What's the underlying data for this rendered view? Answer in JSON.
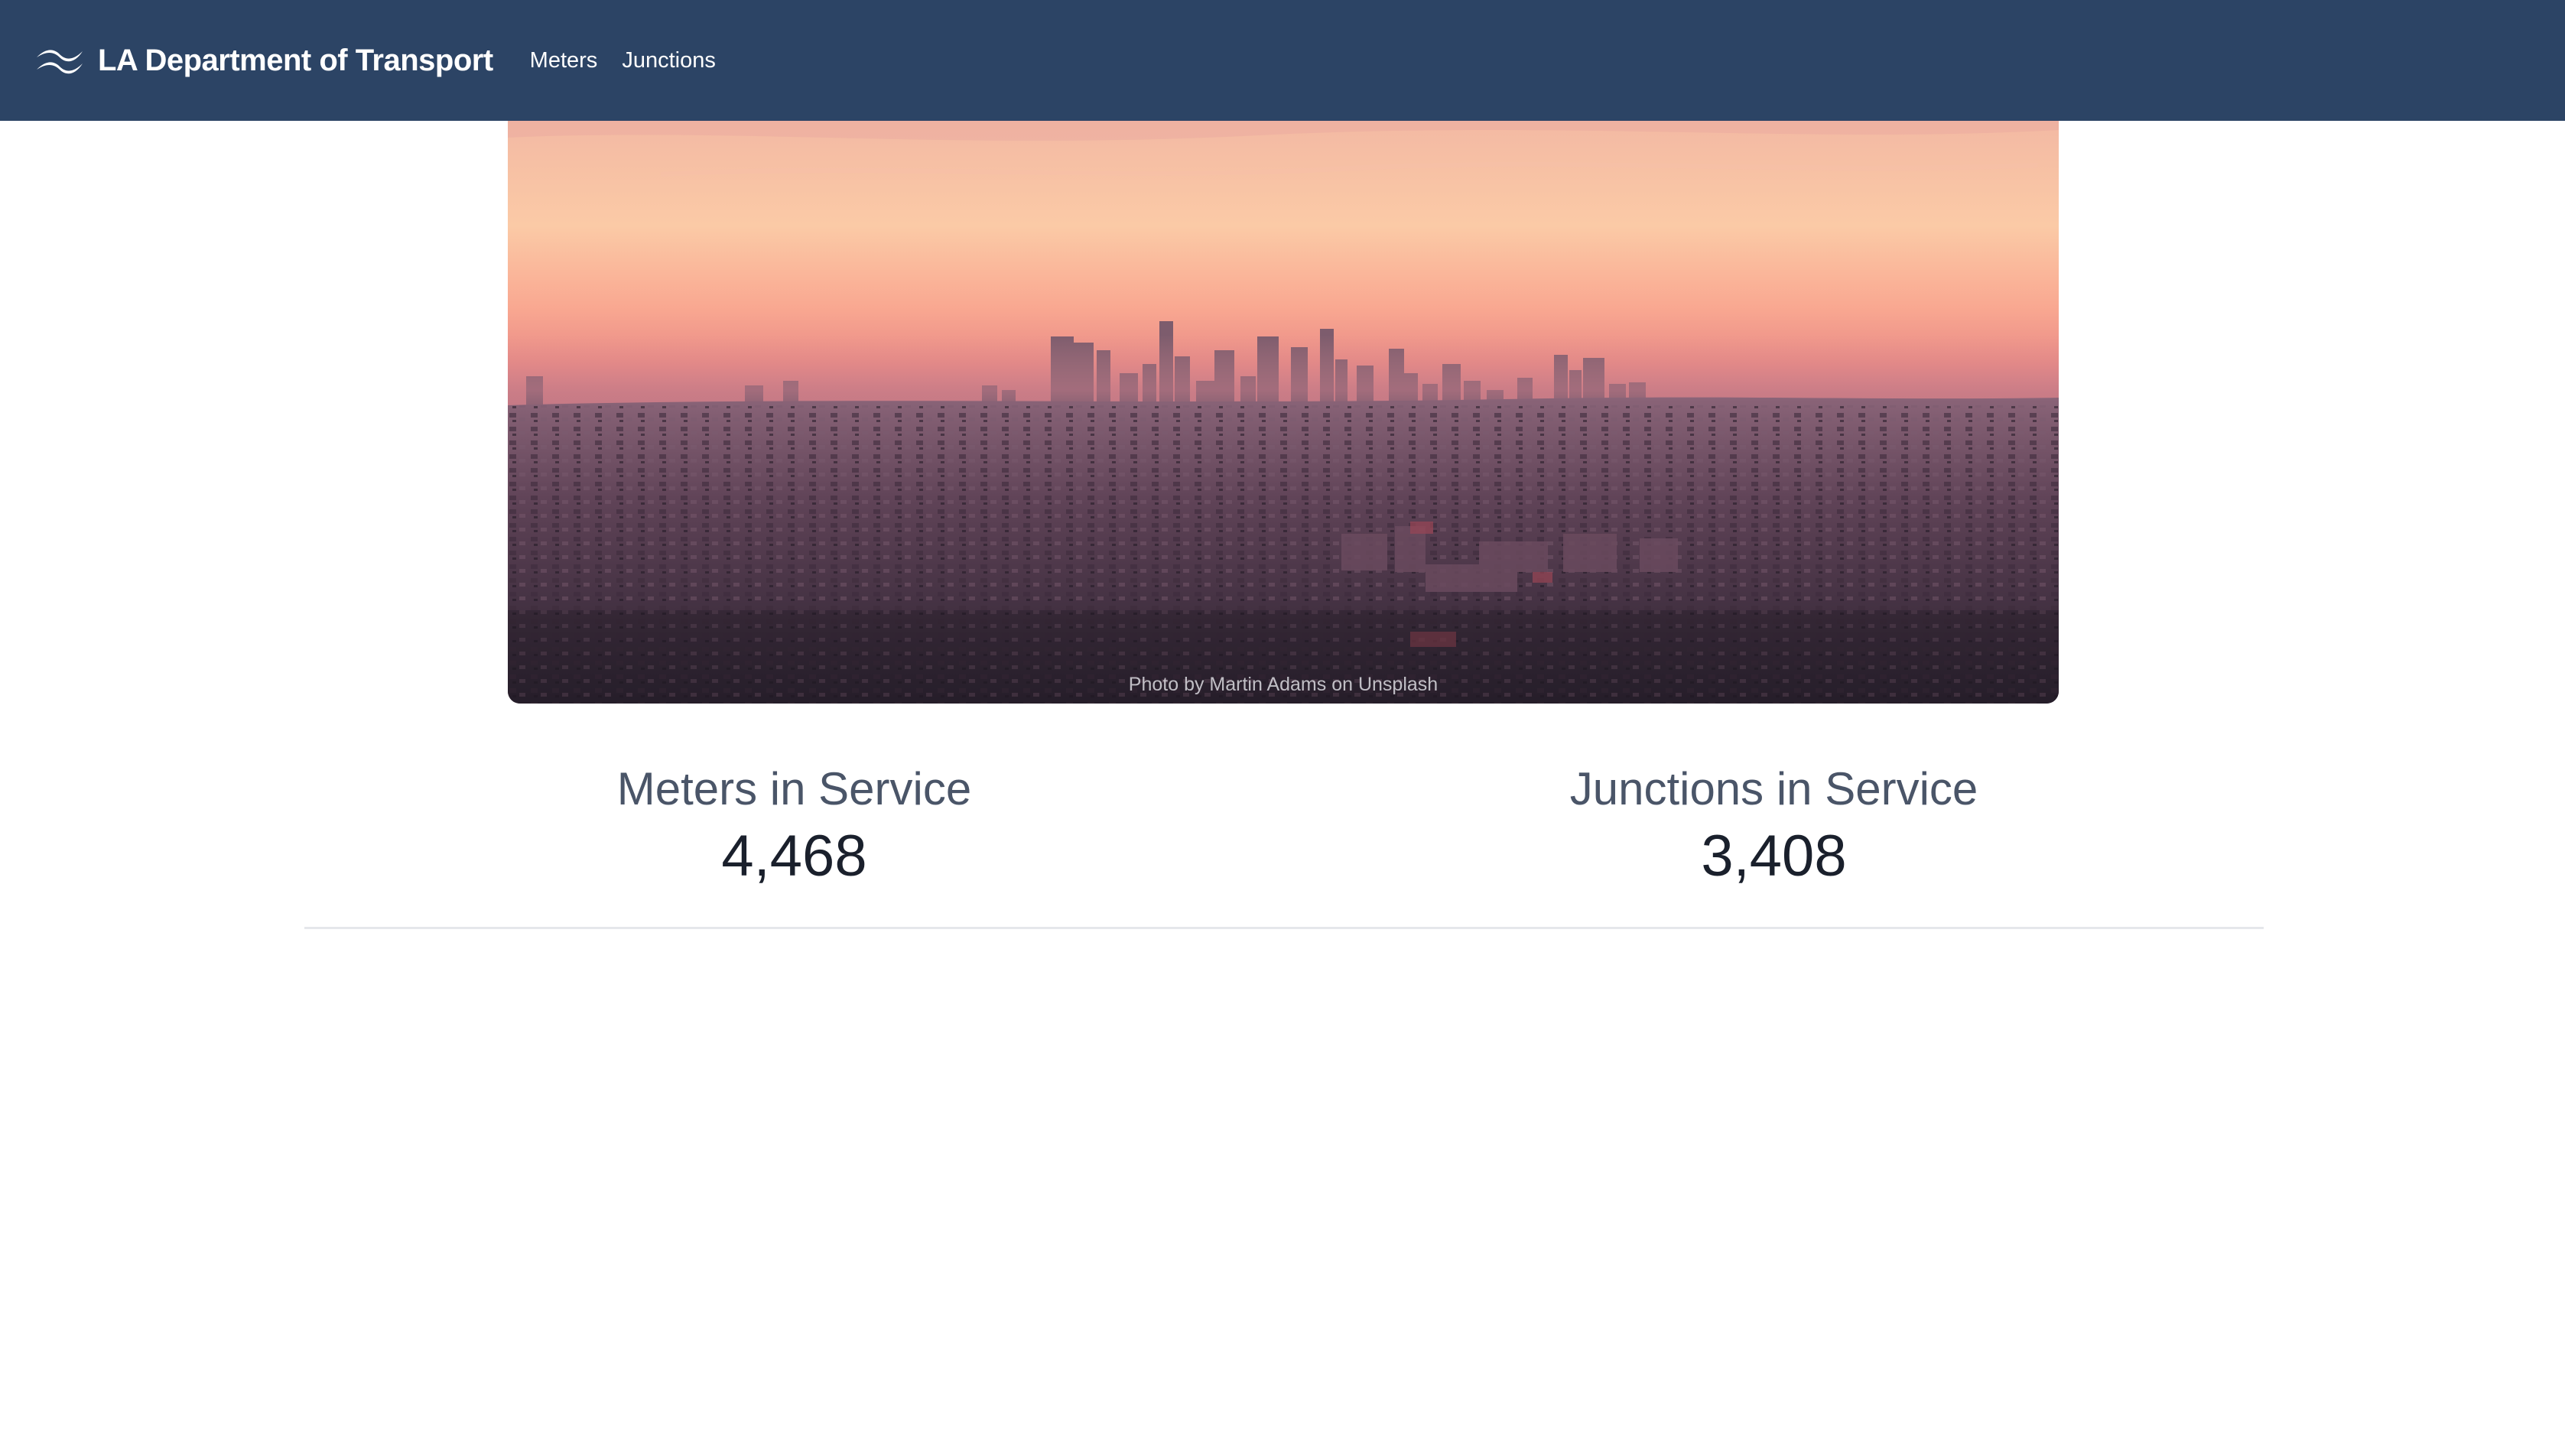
{
  "header": {
    "brand_name": "LA Department of Transport",
    "logo_icon": "wave-logo-icon",
    "nav": [
      {
        "label": "Meters"
      },
      {
        "label": "Junctions"
      }
    ],
    "background_color": "#2c4465"
  },
  "hero": {
    "image_description_icon": "city-skyline-image",
    "credit": "Photo by Martin Adams on Unsplash"
  },
  "stats": [
    {
      "label": "Meters in Service",
      "value": "4,468"
    },
    {
      "label": "Junctions in Service",
      "value": "3,408"
    }
  ]
}
